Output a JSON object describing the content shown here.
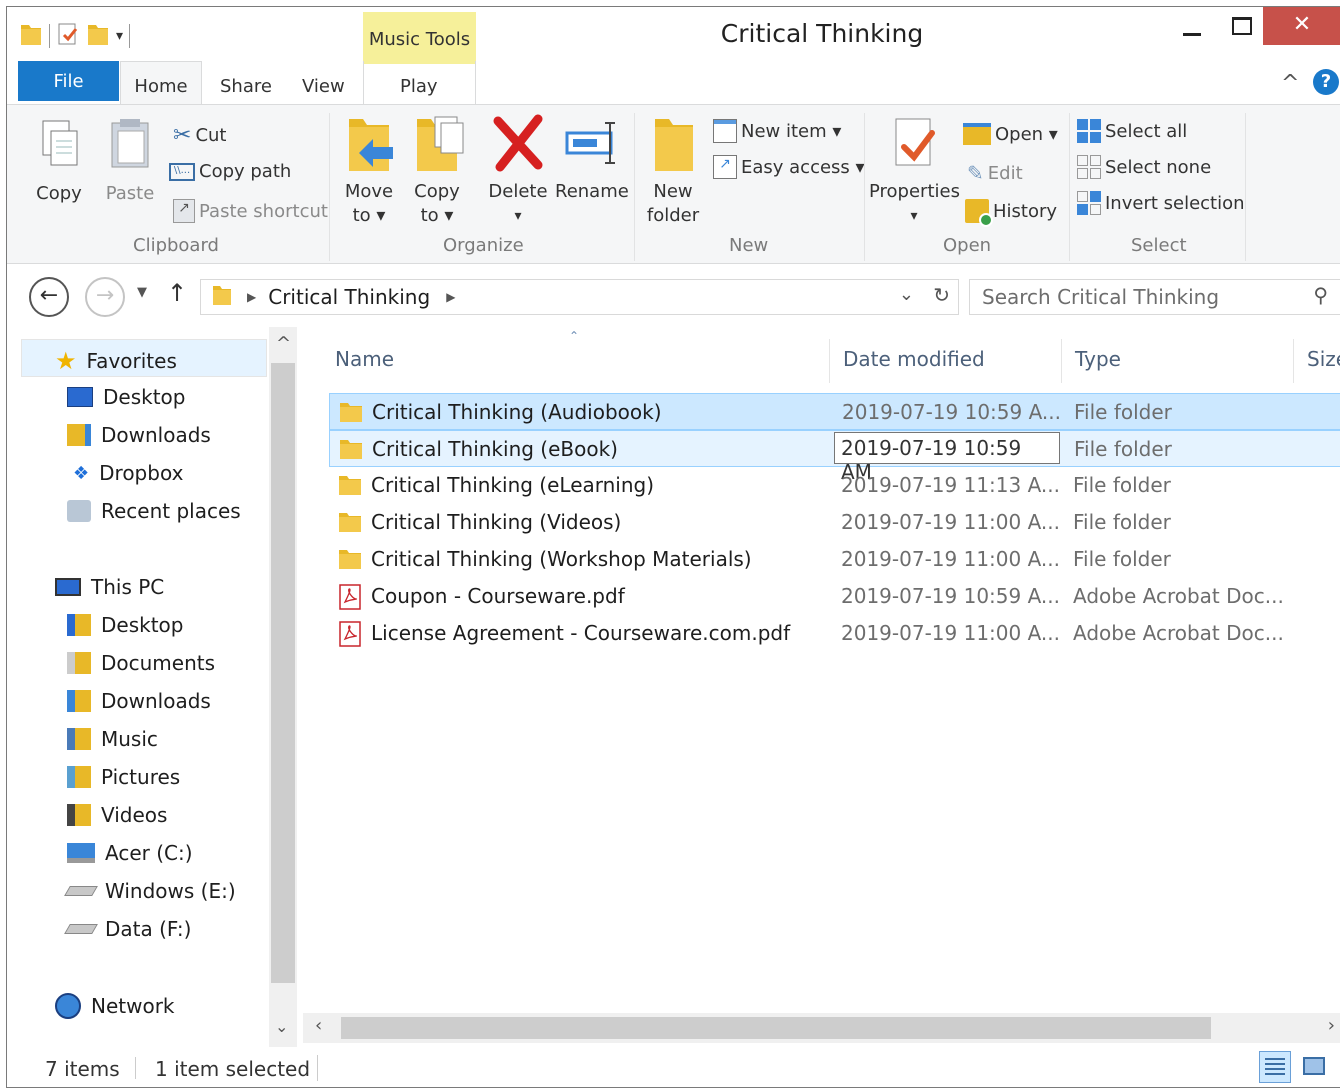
{
  "window": {
    "title": "Critical Thinking",
    "context_tab": "Music Tools",
    "minimize": "—",
    "maximize": "☐",
    "close": "✕"
  },
  "tabs": {
    "file": "File",
    "home": "Home",
    "share": "Share",
    "view": "View",
    "play": "Play"
  },
  "ribbon": {
    "clipboard": {
      "label": "Clipboard",
      "copy": "Copy",
      "paste": "Paste",
      "cut": "Cut",
      "copy_path": "Copy path",
      "paste_shortcut": "Paste shortcut"
    },
    "organize": {
      "label": "Organize",
      "move_to_1": "Move",
      "move_to_2": "to ▾",
      "copy_to_1": "Copy",
      "copy_to_2": "to ▾",
      "delete": "Delete",
      "delete_arrow": "▾",
      "rename": "Rename"
    },
    "new": {
      "label": "New",
      "new_folder_1": "New",
      "new_folder_2": "folder",
      "new_item": "New item ▾",
      "easy_access": "Easy access ▾"
    },
    "open": {
      "label": "Open",
      "properties": "Properties",
      "properties_arrow": "▾",
      "open": "Open ▾",
      "edit": "Edit",
      "history": "History"
    },
    "select": {
      "label": "Select",
      "select_all": "Select all",
      "select_none": "Select none",
      "invert": "Invert selection"
    }
  },
  "address": {
    "path": "Critical Thinking",
    "search_placeholder": "Search Critical Thinking"
  },
  "nav": {
    "favorites": "Favorites",
    "fav_items": [
      "Desktop",
      "Downloads",
      "Dropbox",
      "Recent places"
    ],
    "this_pc": "This PC",
    "pc_items": [
      "Desktop",
      "Documents",
      "Downloads",
      "Music",
      "Pictures",
      "Videos",
      "Acer (C:)",
      "Windows (E:)",
      "Data (F:)"
    ],
    "network": "Network"
  },
  "columns": {
    "name": "Name",
    "date": "Date modified",
    "type": "Type",
    "size": "Size"
  },
  "files": [
    {
      "name": "Critical Thinking (Audiobook)",
      "date": "2019-07-19 10:59 A...",
      "type": "File folder",
      "kind": "folder",
      "state": "selected"
    },
    {
      "name": "Critical Thinking (eBook)",
      "date": "2019-07-19 10:59 AM",
      "type": "File folder",
      "kind": "folder",
      "state": "hover"
    },
    {
      "name": "Critical Thinking (eLearning)",
      "date": "2019-07-19 11:13 A...",
      "type": "File folder",
      "kind": "folder",
      "state": ""
    },
    {
      "name": "Critical Thinking (Videos)",
      "date": "2019-07-19 11:00 A...",
      "type": "File folder",
      "kind": "folder",
      "state": ""
    },
    {
      "name": "Critical Thinking (Workshop Materials)",
      "date": "2019-07-19 11:00 A...",
      "type": "File folder",
      "kind": "folder",
      "state": ""
    },
    {
      "name": "Coupon - Courseware.pdf",
      "date": "2019-07-19 10:59 A...",
      "type": "Adobe Acrobat Doc...",
      "kind": "pdf",
      "state": ""
    },
    {
      "name": "License Agreement - Courseware.com.pdf",
      "date": "2019-07-19 11:00 A...",
      "type": "Adobe Acrobat Doc...",
      "kind": "pdf",
      "state": ""
    }
  ],
  "status": {
    "count": "7 items",
    "selected": "1 item selected"
  },
  "colors": {
    "accent": "#1979ca",
    "selection": "#cce8ff",
    "context_tab": "#f6f09a"
  }
}
